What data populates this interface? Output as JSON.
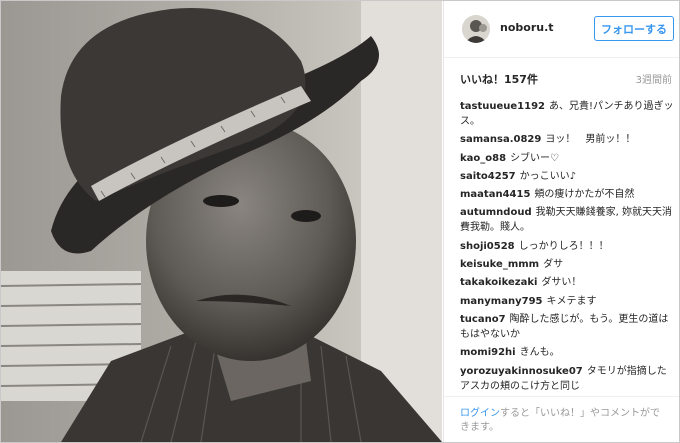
{
  "post": {
    "username": "noboru.t",
    "follow_label": "フォローする",
    "likes": "いいね！157件",
    "time": "3週間前"
  },
  "comments": [
    {
      "user": "tastuueue1192",
      "text": "あ、兄貴!パンチあり過ぎッス。"
    },
    {
      "user": "samansa.0829",
      "text": "ヨッ！　男前ッ！！"
    },
    {
      "user": "kao_o88",
      "text": "シブいー♡"
    },
    {
      "user": "saito4257",
      "text": "かっこいい♪"
    },
    {
      "user": "maatan4415",
      "text": "頬の痩けかたが不自然"
    },
    {
      "user": "autumndoud",
      "text": "我勒天天賺錢養家, 妳就天天消費我勒。賤人。"
    },
    {
      "user": "shoji0528",
      "text": "しっかりしろ！！！"
    },
    {
      "user": "keisuke_mmm",
      "text": "ダサ"
    },
    {
      "user": "takakoikezaki",
      "text": "ダサい！"
    },
    {
      "user": "manymany795",
      "text": "キメテます"
    },
    {
      "user": "tucano7",
      "text": "陶酔した感じが。もう。更生の道はもはやないか"
    },
    {
      "user": "momi92hi",
      "text": "きんも。"
    },
    {
      "user": "yorozuyakinnosuke07",
      "text": "タモリが指摘したアスカの頬のこけ方と同じ"
    }
  ],
  "footer": {
    "login_link": "ログイン",
    "text": "すると「いいね！」やコメントができます。"
  }
}
